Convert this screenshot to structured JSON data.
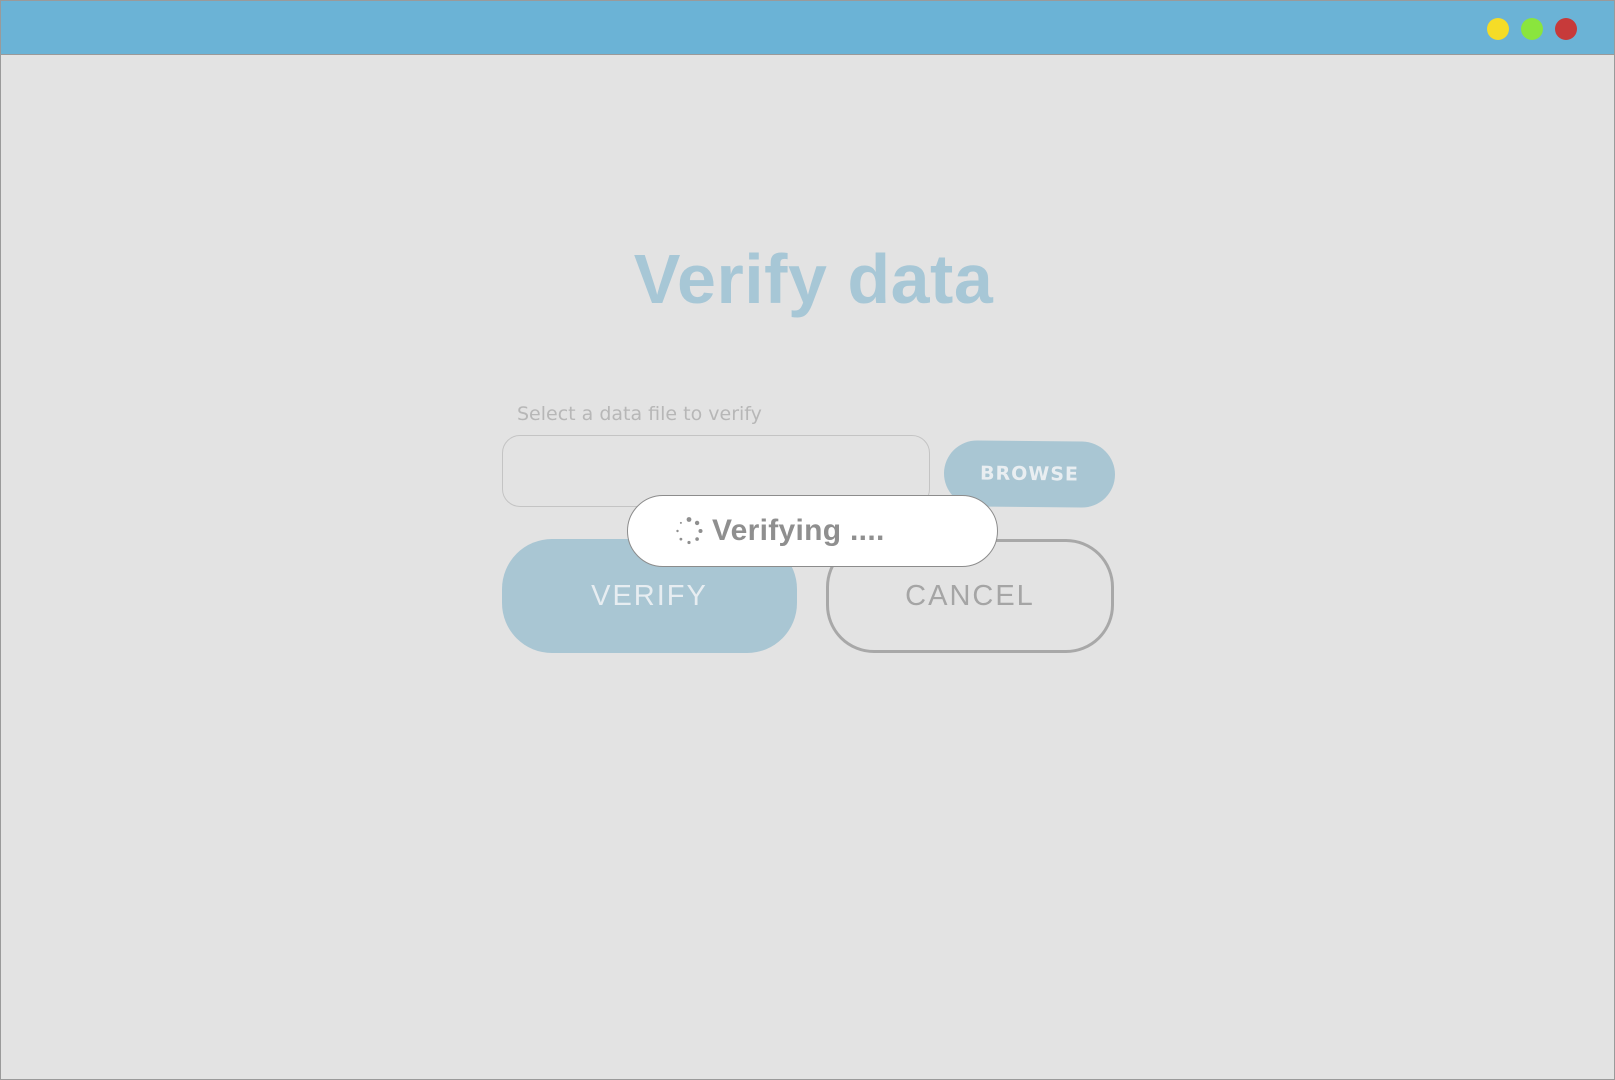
{
  "window": {
    "title_bar_color": "#6bb3d6",
    "controls": {
      "minimize_color": "#f5dc27",
      "maximize_color": "#8ae53d",
      "close_color": "#c73a3a"
    }
  },
  "colors": {
    "accent_muted": "#a9c6d3",
    "title_text": "#a7c7d6",
    "background": "#e3e3e3"
  },
  "main": {
    "title": "Verify data",
    "file_field": {
      "label": "Select a data file to verify",
      "value": "",
      "placeholder": ""
    },
    "browse_label": "BROWSE",
    "verify_label": "VERIFY",
    "cancel_label": "CANCEL"
  },
  "status_toast": {
    "icon": "spinner-icon",
    "text": "Verifying ...."
  }
}
